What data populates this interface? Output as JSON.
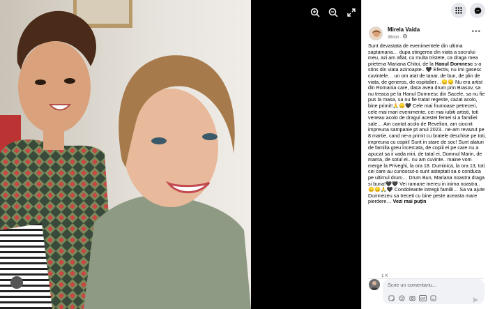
{
  "viewer": {
    "zoom_in": "zoom-in-icon",
    "zoom_out": "zoom-out-icon",
    "fullscreen": "fullscreen-icon"
  },
  "topbar": {
    "menu": "grid-menu-icon",
    "messenger": "messenger-icon"
  },
  "post": {
    "author": "Mirela Vaida",
    "time": "38min",
    "privacy_icon": "globe-icon",
    "paragraphs": [
      "Sunt devastata de evenimentele din ultima saptamana… dupa stingerea din viata a socrului meu, azi am aflat, cu multa tristete, ca draga mea prietena Mariana Chitoi, de la ",
      "Hanul Domnesc",
      " s-a stins din viata azinoapte..",
      " Efectiv, nu imi gasesc cuvintele… un om atat de tanar, de bun, de plin de viata, de generos, de ospitalier…",
      " Nu era artist din Romania care, daca avea drum prin Brasov, sa nu treaca pe la Hanul Domnesc din Sacele, sa nu fie pus la masa, sa nu fie tratat regeste, cazat acolo, bine primit!",
      " Cele mai frumoase petreceri, cele mai mari evenimente, cei mai iubiti artisti, toti veneau acolo de dragul acestei femei si a familiei sale… Am cantat acolo de Revelion, am ciocnit impreuna sampanie pt anul 2023.. ne-am revazut pe 8 martie, cand ne-a primit cu bratele deschise pe toti, impreuna cu copiii! Sunt in stare de soc! Sunt alaturi de familia greu incercata, de copiii ei pe care nu a apucat sa ii vada miri, de tatal ei, Domnul Marin, de mama, de sotul ei.. nu am cuvinte.. maine vom merge la Priveghi, la ora 18. Duminica, la ora 13, toti cei care au cunoscut-o sunt asteptati sa o conduca pe ultimul drum… Drum Bun, Mariana noastra draga si buna!",
      " Vei ramane mereu in inima noastra..",
      " Condoleante intregii familii… Sa va ajute Dumnezeu sa treceti cu bine peste aceasta mare pierdere… "
    ],
    "see_less": "Vezi mai puțin",
    "reactions_count": "1 K"
  },
  "comment": {
    "placeholder": "Scrie un comentariu...",
    "icons": [
      "sticker-icon",
      "emoji-icon",
      "camera-icon",
      "gif-icon",
      "smiley-sticker-icon"
    ],
    "send_icon": "send-icon"
  }
}
